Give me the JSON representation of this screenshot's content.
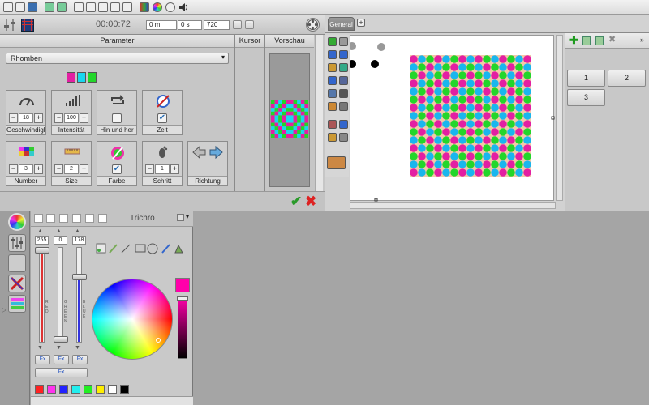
{
  "toolbar": {
    "time": "00:00:72",
    "pos_m": "0 m",
    "pos_s": "0 s",
    "frames": "720"
  },
  "parameter": {
    "title": "Parameter",
    "effect_select": "Rhomben",
    "swatches": [
      "#e31fa2",
      "#19d6ee",
      "#23d62a"
    ],
    "tiles_row1": [
      {
        "label": "Geschwindigkeit",
        "value": "18",
        "icon": "speedometer-icon"
      },
      {
        "label": "Intensität",
        "value": "100",
        "icon": "signal-bars-icon"
      },
      {
        "label": "Hin und her",
        "icon": "loop-arrows-icon",
        "checked": false
      },
      {
        "label": "Zeit",
        "icon": "clock-off-icon",
        "checked": true
      }
    ],
    "tiles_row2": [
      {
        "label": "Number",
        "value": "3",
        "icon": "color-grid-icon"
      },
      {
        "label": "Size",
        "value": "2",
        "icon": "ruler-icon"
      },
      {
        "label": "Farbe",
        "icon": "color-picker-icon",
        "checked": true
      },
      {
        "label": "Schritt",
        "value": "1",
        "icon": "footprint-icon"
      },
      {
        "label": "Richtung",
        "icon": "left-right-arrows-icon"
      }
    ]
  },
  "kursor": {
    "title": "Kursor"
  },
  "vorschau": {
    "title": "Vorschau"
  },
  "tabs": {
    "general": "General"
  },
  "groups": {
    "items": [
      "1",
      "2",
      "3"
    ]
  },
  "color_panel": {
    "title": "Trichro",
    "sliders": [
      {
        "value": "255",
        "label": "RED",
        "level": 1.0,
        "fill": "#d33"
      },
      {
        "value": "0",
        "label": "GREEN",
        "level": 0.0,
        "fill": "#3a3"
      },
      {
        "value": "178",
        "label": "BLUE",
        "level": 0.7,
        "fill": "#33d"
      }
    ],
    "fx_small": [
      "Fx",
      "Fx",
      "Fx"
    ],
    "fx_wide": "Fx",
    "current_color": "#ff00aa",
    "palette": [
      "#ff2222",
      "#ff33ee",
      "#2222ff",
      "#22eeee",
      "#22ee22",
      "#ffee00",
      "#ffffff",
      "#000000"
    ]
  }
}
